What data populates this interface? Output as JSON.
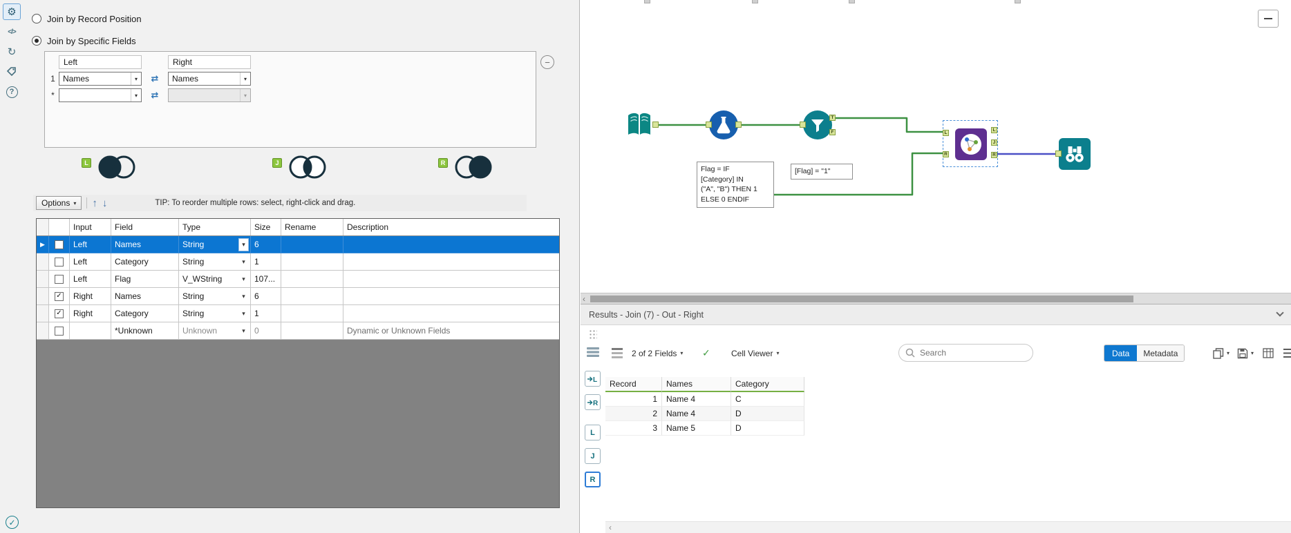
{
  "colors": {
    "accent_blue": "#0c76d2",
    "alteryx_green": "#8cc63e",
    "teal": "#0c7f8d",
    "formula_blue": "#175fae",
    "join_purple": "#5e2f90",
    "wire_green": "#3d9142",
    "wire_blue": "#4b50c6",
    "venn_dark": "#17303d"
  },
  "icons": {
    "swap_arrows": "⇄",
    "up_arrow": "↑",
    "down_arrow": "↓",
    "minus": "−",
    "gear": "⚙",
    "code": "</>",
    "refresh": "↻",
    "help": "?",
    "valid_check": "✓",
    "back_arrow": "‹"
  },
  "config": {
    "radios": [
      {
        "label": "Join by Record Position",
        "selected": false
      },
      {
        "label": "Join by Specific Fields",
        "selected": true
      }
    ],
    "join_fields": {
      "left_header": "Left",
      "right_header": "Right",
      "rows": [
        {
          "num": "1",
          "left": "Names",
          "right": "Names"
        },
        {
          "num": "*",
          "left": "",
          "right": ""
        }
      ]
    },
    "venns": [
      {
        "badge": "L"
      },
      {
        "badge": "J"
      },
      {
        "badge": "R"
      }
    ],
    "options_label": "Options",
    "tip": "TIP: To reorder multiple rows: select, right-click and drag.",
    "grid": {
      "headers": {
        "input": "Input",
        "field": "Field",
        "type": "Type",
        "size": "Size",
        "rename": "Rename",
        "description": "Description"
      },
      "rows": [
        {
          "checked": false,
          "selected": true,
          "input": "Left",
          "field": "Names",
          "type": "String",
          "size": "6",
          "rename": "",
          "description": ""
        },
        {
          "checked": false,
          "selected": false,
          "input": "Left",
          "field": "Category",
          "type": "String",
          "size": "1",
          "rename": "",
          "description": ""
        },
        {
          "checked": false,
          "selected": false,
          "input": "Left",
          "field": "Flag",
          "type": "V_WString",
          "size": "107...",
          "rename": "",
          "description": ""
        },
        {
          "checked": true,
          "selected": false,
          "input": "Right",
          "field": "Names",
          "type": "String",
          "size": "6",
          "rename": "",
          "description": ""
        },
        {
          "checked": true,
          "selected": false,
          "input": "Right",
          "field": "Category",
          "type": "String",
          "size": "1",
          "rename": "",
          "description": ""
        },
        {
          "checked": false,
          "selected": false,
          "input": "",
          "field": "*Unknown",
          "type": "Unknown",
          "size": "0",
          "rename": "",
          "description": "Dynamic or Unknown Fields"
        }
      ]
    }
  },
  "canvas": {
    "formula_annotation": "Flag = IF\n[Category] IN\n(\"A\", \"B\") THEN 1\nELSE 0 ENDIF",
    "filter_annotation": "[Flag] = \"1\"",
    "filter_outputs": {
      "t": "T",
      "f": "F"
    },
    "join_inputs": {
      "l": "L",
      "r": "R"
    },
    "join_outputs": {
      "l": "L",
      "j": "J",
      "r": "R"
    }
  },
  "results": {
    "title": "Results - Join (7) - Out - Right",
    "toolbar": {
      "fields": "2 of 2 Fields",
      "cell_viewer": "Cell Viewer",
      "search_placeholder": "Search",
      "data": "Data",
      "metadata": "Metadata"
    },
    "tabs": {
      "input_left": "L",
      "input_right": "R",
      "out_left": "L",
      "out_join": "J",
      "out_right": "R"
    },
    "table": {
      "headers": [
        "Record",
        "Names",
        "Category"
      ],
      "rows": [
        [
          "1",
          "Name 4",
          "C"
        ],
        [
          "2",
          "Name 4",
          "D"
        ],
        [
          "3",
          "Name 5",
          "D"
        ]
      ]
    }
  }
}
